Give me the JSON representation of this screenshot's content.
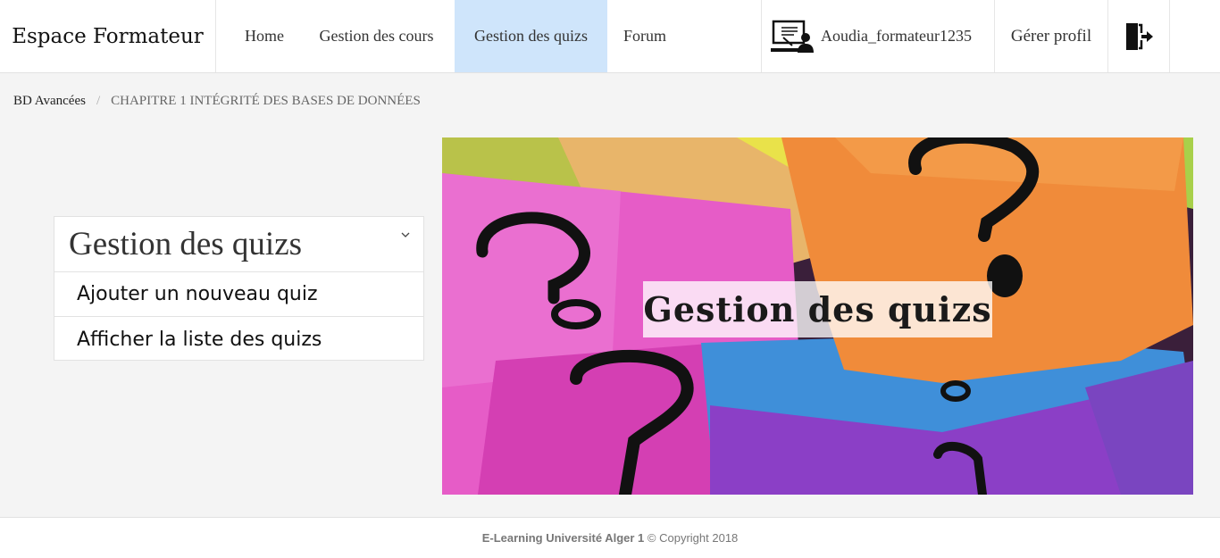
{
  "navbar": {
    "brand": "Espace Formateur",
    "items": [
      {
        "label": "Home"
      },
      {
        "label": "Gestion des cours"
      },
      {
        "label": "Gestion des quizs"
      },
      {
        "label": "Forum"
      }
    ],
    "active_index": 2,
    "active_color": "#cfe5fb",
    "user_icon": "teacher-icon",
    "username": "Aoudia_formateur1235",
    "profile_label": "Gérer profil",
    "logout_icon": "logout-icon"
  },
  "breadcrumb": {
    "items": [
      "BD Avancées",
      "CHAPITRE 1 INTÉGRITÉ DES BASES DE DONNÉES"
    ],
    "separator": "/"
  },
  "sidebar": {
    "title": "Gestion des quizs",
    "toggle_icon": "chevron-down-icon",
    "links": [
      {
        "label": "Ajouter un nouveau quiz"
      },
      {
        "label": "Afficher la liste des quizs"
      }
    ]
  },
  "hero": {
    "label": "Gestion des quizs"
  },
  "footer": {
    "brand": "E-Learning Université Alger 1",
    "copyright": "© Copyright 2018"
  }
}
